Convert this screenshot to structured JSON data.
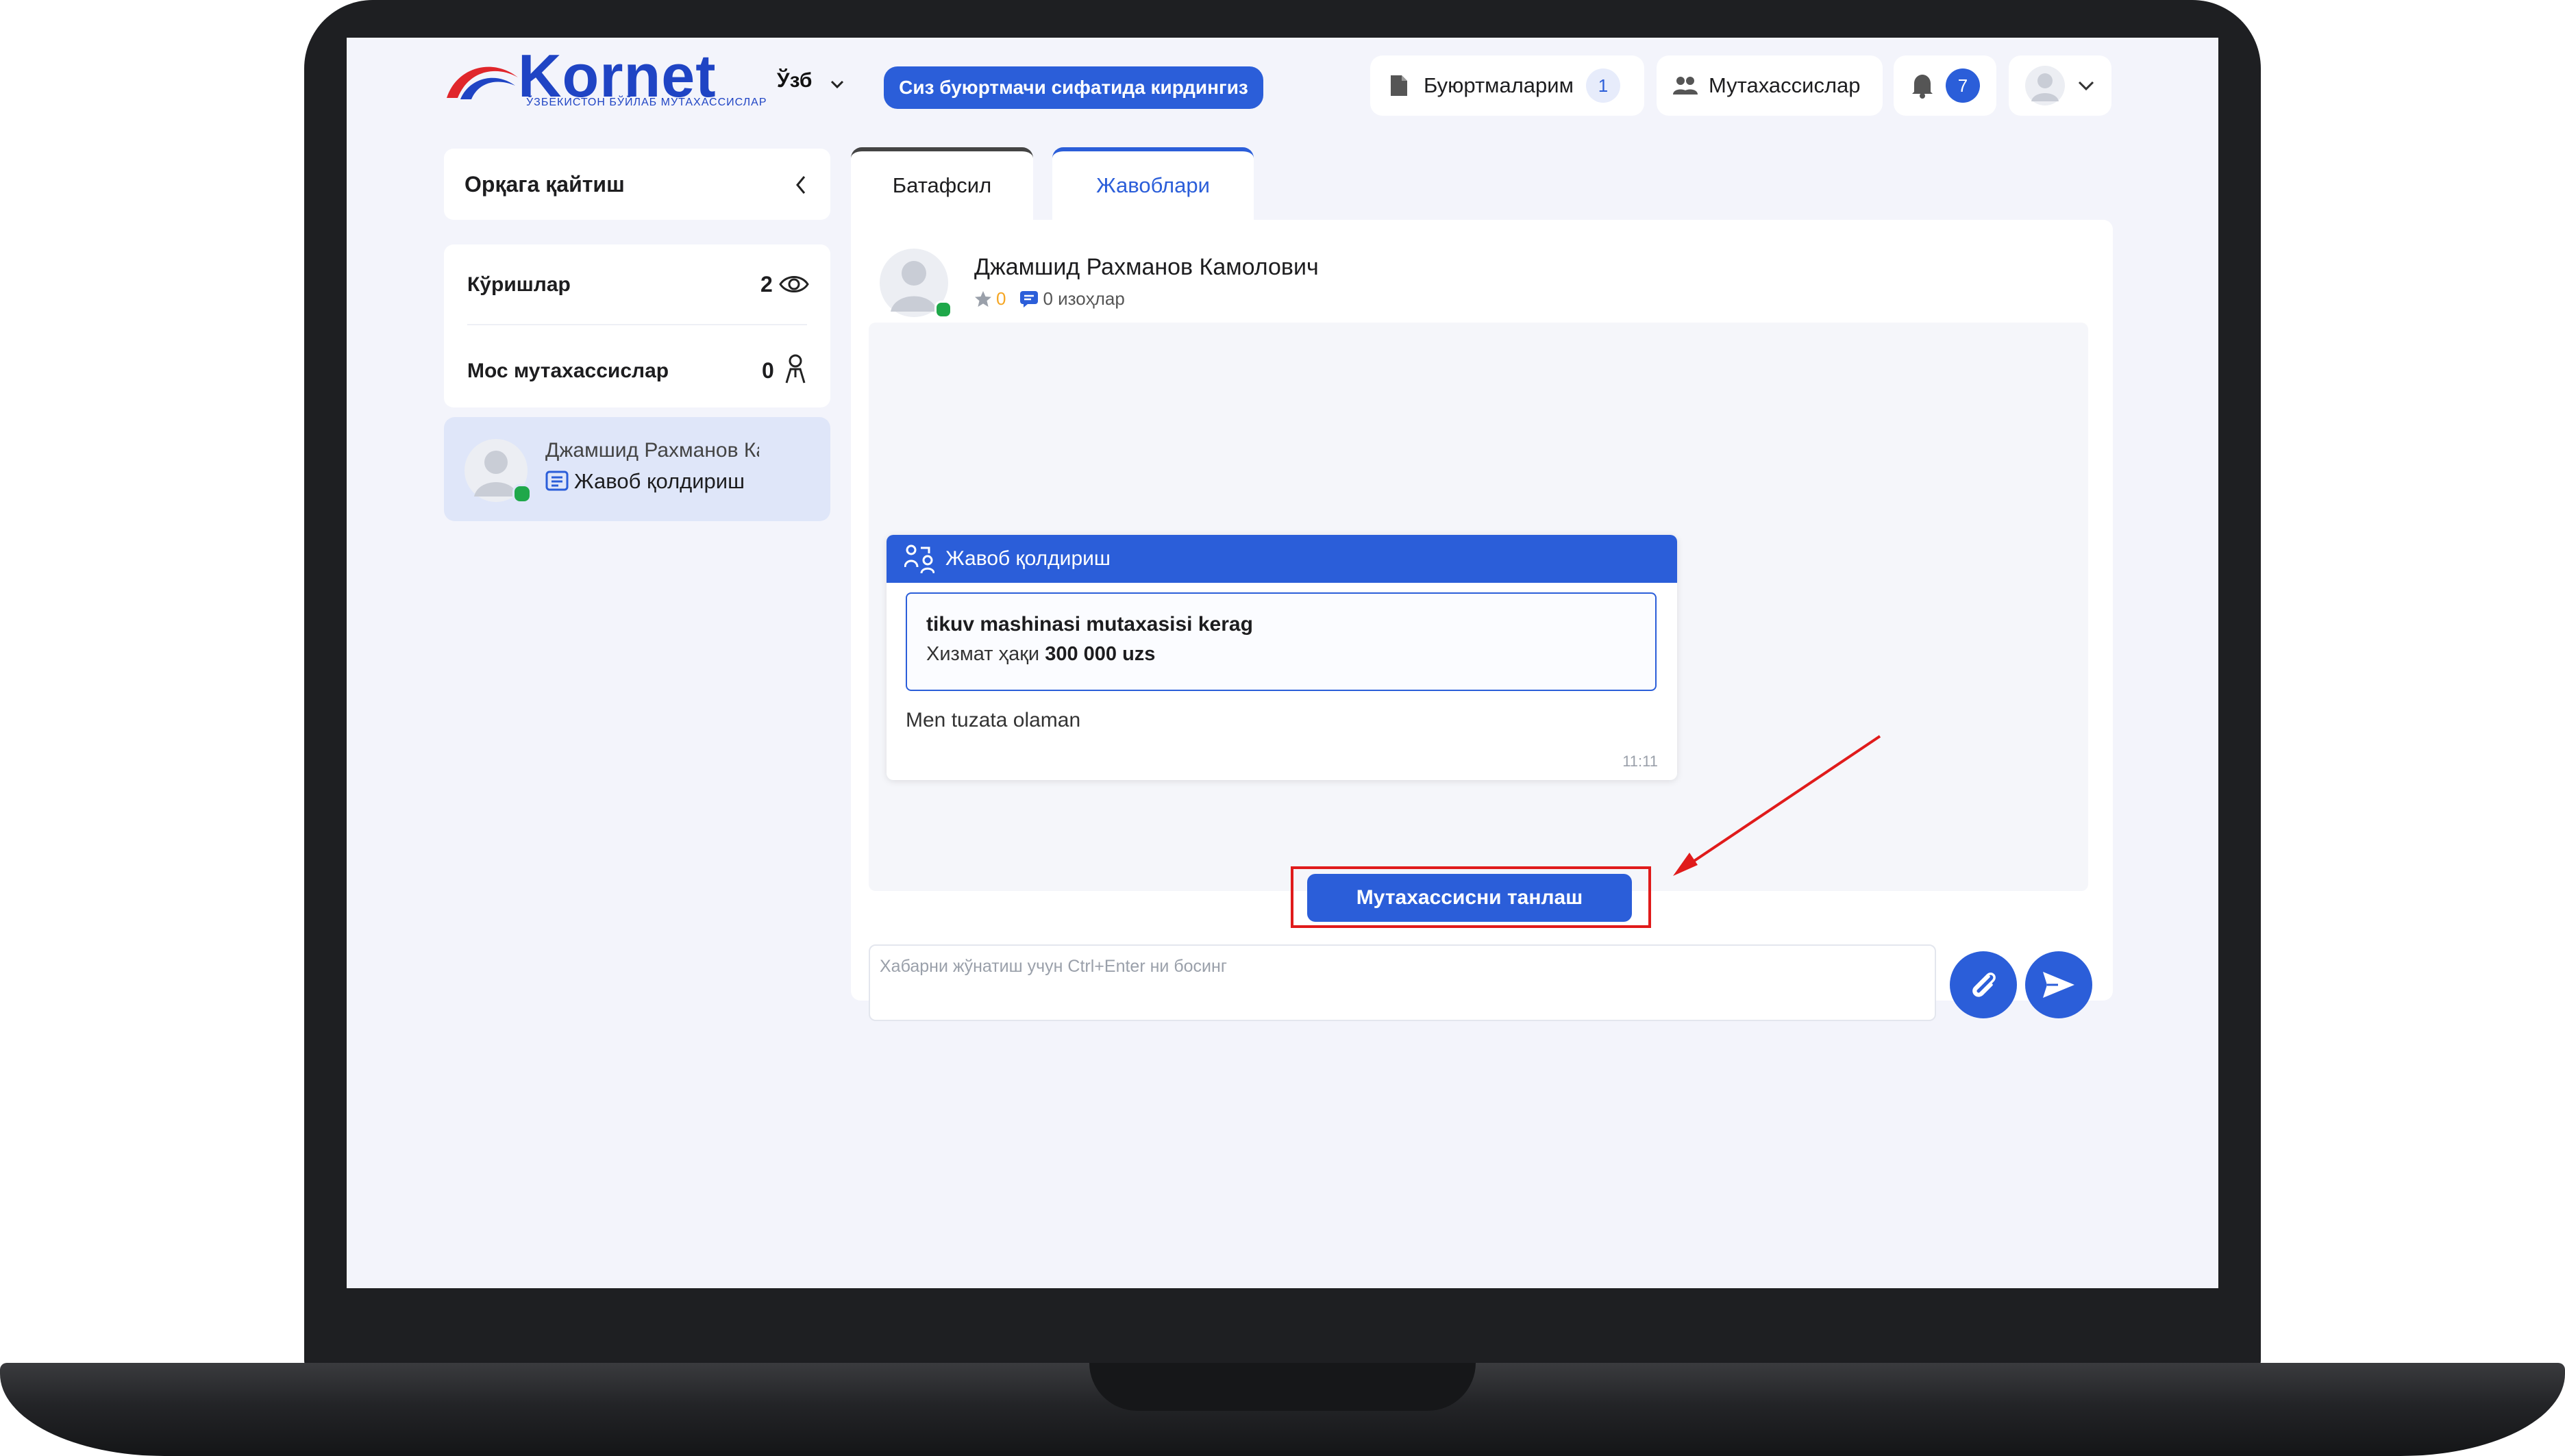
{
  "brand": {
    "name": "Kornet",
    "tagline": "ЎЗБЕКИСТОН БЎЙЛАБ МУТАХАССИСЛАР"
  },
  "header": {
    "language": "Ўзб",
    "role_button": "Сиз буюртмачи сифатида кирдингиз",
    "orders_label": "Буюртмаларим",
    "orders_count": "1",
    "specialists_label": "Мутахассислар",
    "notifications_count": "7"
  },
  "sidebar": {
    "back_label": "Орқага қайтиш",
    "stats": [
      {
        "label": "Кўришлар",
        "value": "2"
      },
      {
        "label": "Мос мутахассислар",
        "value": "0"
      }
    ],
    "response": {
      "name": "Джамшид Рахманов Камолович",
      "action": "Жавоб қолдириш"
    }
  },
  "tabs": [
    {
      "label": "Батафсил",
      "active": false
    },
    {
      "label": "Жавоблари",
      "active": true
    }
  ],
  "specialist": {
    "name": "Джамшид Рахманов Камолович",
    "rating": "0",
    "reviews": "0 изоҳлар"
  },
  "message": {
    "header": "Жавоб қолдириш",
    "task_title": "tikuv mashinasi mutaxasisi kerag",
    "price_label": "Хизмат ҳақи",
    "price_value": "300 000 uzs",
    "text": "Men tuzata olaman",
    "time": "11:11"
  },
  "actions": {
    "choose_specialist": "Мутахассисни танлаш"
  },
  "composer": {
    "placeholder": "Хабарни жўнатиш учун Ctrl+Enter ни босинг",
    "value": ""
  },
  "colors": {
    "accent": "#2b5ed9",
    "logo_red": "#e0262b",
    "highlight": "#e01b1b",
    "online": "#1fa84a",
    "star": "#f5a623"
  }
}
